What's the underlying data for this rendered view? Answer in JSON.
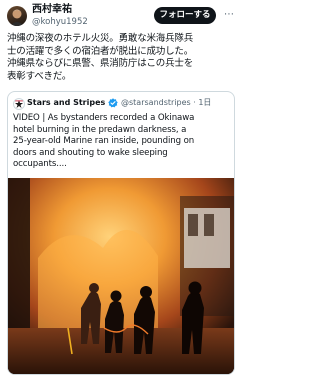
{
  "author": {
    "display_name": "西村幸祐",
    "handle": "@kohyu1952"
  },
  "follow_label": "フォローする",
  "more_glyph": "⋯",
  "tweet_lines": [
    "沖縄の深夜のホテル火災。勇敢な米海兵隊兵",
    "士の活躍で多くの宿泊者が脱出に成功した。",
    "沖縄県ならびに県警、県消防庁はこの兵士を",
    "表彰すべきだ。"
  ],
  "quoted": {
    "name": "Stars and Stripes",
    "handle_time": "@starsandstripes · 1日",
    "body_lines": [
      "VIDEO | As bystanders recorded a Okinawa",
      "hotel burning in the predawn darkness, a",
      "25-year-old Marine ran inside, pounding on",
      "doors and shouting to wake sleeping",
      "occupants...."
    ]
  },
  "colors": {
    "text": "#0f1419",
    "secondary": "#536471",
    "verified": "#1d9bf0",
    "button": "#0f1419",
    "fire": "#f5a623"
  }
}
